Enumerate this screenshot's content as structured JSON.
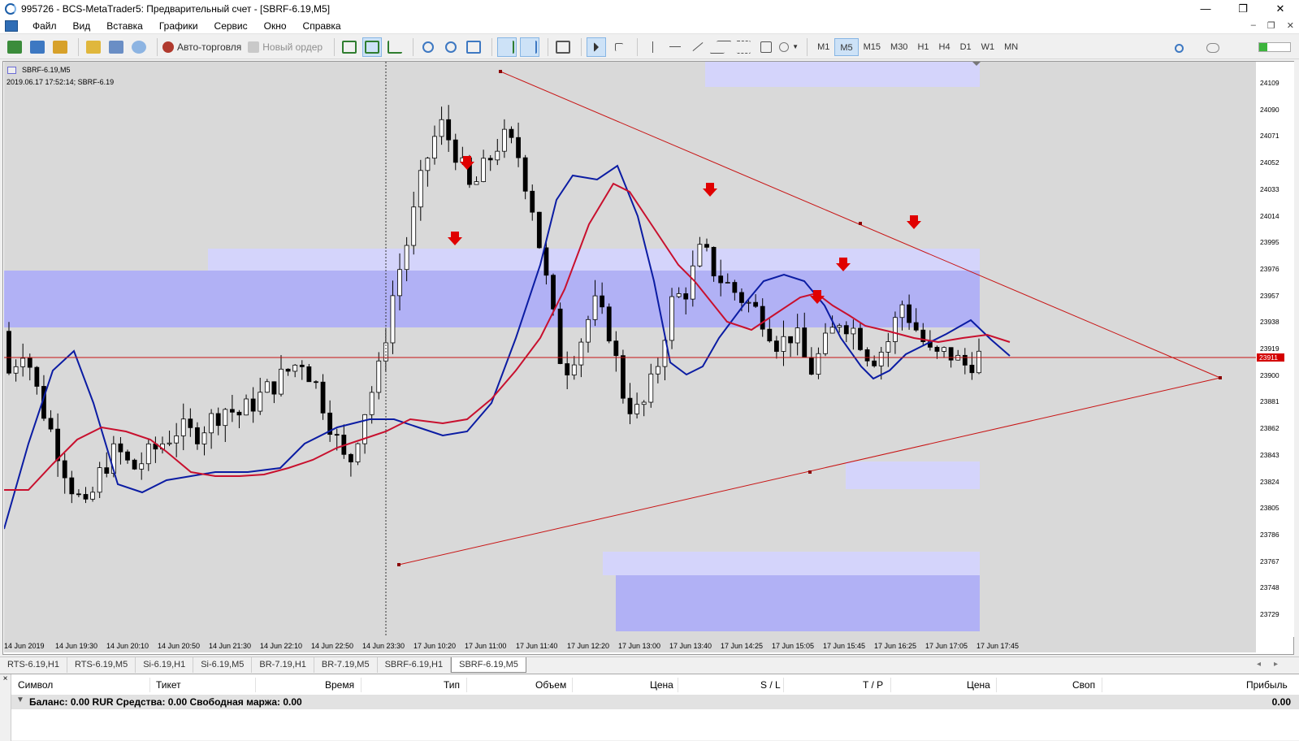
{
  "window": {
    "title": "995726 - BCS-MetaTrader5: Предварительный счет - [SBRF-6.19,M5]",
    "minimize": "—",
    "maximize": "❐",
    "close": "✕"
  },
  "menu": {
    "items": [
      "Файл",
      "Вид",
      "Вставка",
      "Графики",
      "Сервис",
      "Окно",
      "Справка"
    ],
    "mdi_controls": [
      "–",
      "❐",
      "✕"
    ]
  },
  "toolbar": {
    "auto_trading": "Авто-торговля",
    "new_order": "Новый ордер",
    "timeframes": [
      "M1",
      "M5",
      "M15",
      "M30",
      "H1",
      "H4",
      "D1",
      "W1",
      "MN"
    ],
    "active_timeframe": "M5"
  },
  "chart": {
    "symbol_label": "SBRF-6.19,M5",
    "info_line": "2019.06.17 17:52:14; SBRF-6.19",
    "current_price": "23911",
    "price_labels": [
      "24109",
      "24090",
      "24071",
      "24052",
      "24033",
      "24014",
      "23995",
      "23976",
      "23957",
      "23938",
      "23919",
      "23900",
      "23881",
      "23862",
      "23843",
      "23824",
      "23805",
      "23786",
      "23767",
      "23748",
      "23729"
    ],
    "time_labels": [
      "14 Jun 2019",
      "14 Jun 19:30",
      "14 Jun 20:10",
      "14 Jun 20:50",
      "14 Jun 21:30",
      "14 Jun 22:10",
      "14 Jun 22:50",
      "14 Jun 23:30",
      "17 Jun 10:20",
      "17 Jun 11:00",
      "17 Jun 11:40",
      "17 Jun 12:20",
      "17 Jun 13:00",
      "17 Jun 13:40",
      "17 Jun 14:25",
      "17 Jun 15:05",
      "17 Jun 15:45",
      "17 Jun 16:25",
      "17 Jun 17:05",
      "17 Jun 17:45"
    ],
    "colors": {
      "background": "#d9d9d9",
      "zone_light": "#d4d4fb",
      "zone_dark": "#b1b1f5",
      "ma_fast": "#0b1ca3",
      "ma_slow": "#c8102e",
      "trend_line": "#c81414",
      "arrow": "#e00000"
    }
  },
  "tabs": {
    "items": [
      "RTS-6.19,H1",
      "RTS-6.19,M5",
      "Si-6.19,H1",
      "Si-6.19,M5",
      "BR-7.19,H1",
      "BR-7.19,M5",
      "SBRF-6.19,H1",
      "SBRF-6.19,M5"
    ],
    "active": "SBRF-6.19,M5"
  },
  "terminal": {
    "close_glyph": "×",
    "columns": [
      "Символ",
      "Тикет",
      "Время",
      "Тип",
      "Объем",
      "Цена",
      "S / L",
      "T / P",
      "Цена",
      "Своп",
      "Прибыль"
    ],
    "balance_line": "Баланс: 0.00 RUR  Средства: 0.00  Свободная маржа: 0.00",
    "profit": "0.00"
  }
}
